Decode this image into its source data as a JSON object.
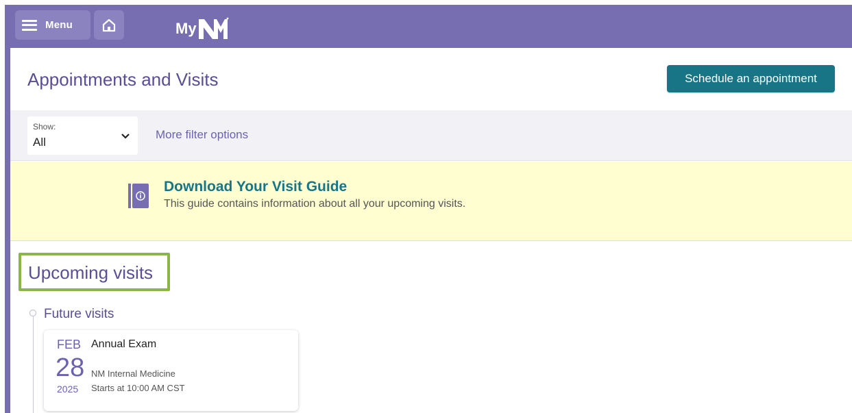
{
  "header": {
    "menu_label": "Menu",
    "logo_prefix": "My",
    "background_color": "#766eb1"
  },
  "page": {
    "title": "Appointments and Visits",
    "schedule_button": "Schedule an appointment"
  },
  "filter": {
    "show_label": "Show:",
    "show_value": "All",
    "more_options_link": "More filter options"
  },
  "guide": {
    "title": "Download Your Visit Guide",
    "description": "This guide contains information about all your upcoming visits."
  },
  "upcoming": {
    "section_title": "Upcoming visits",
    "group_title": "Future visits",
    "visits": [
      {
        "month": "FEB",
        "day": "28",
        "year": "2025",
        "type": "Annual Exam",
        "department": "NM Internal Medicine",
        "time": "Starts at 10:00 AM CST"
      }
    ]
  },
  "colors": {
    "accent_purple": "#766eb1",
    "title_purple": "#5b4d96",
    "teal_button": "#187585",
    "banner_yellow": "#fefed1",
    "highlight_green": "#8ab549"
  },
  "icons": {
    "menu": "hamburger-icon",
    "home": "home-icon",
    "select": "chevron-down-icon",
    "guide": "guide-book-icon"
  }
}
